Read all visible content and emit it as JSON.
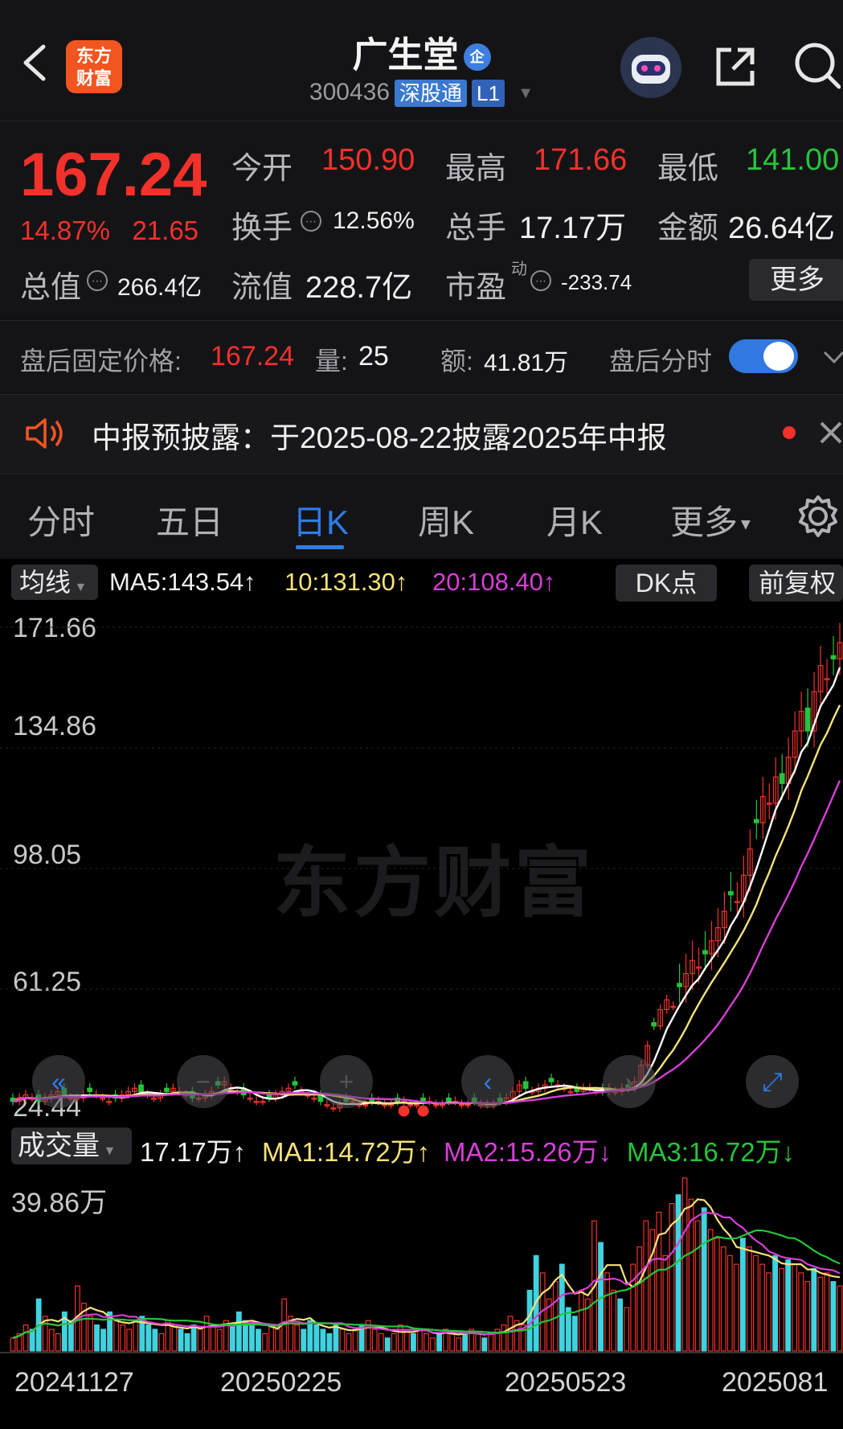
{
  "header": {
    "back_icon": "chevron-left-icon",
    "logo_line1": "东方",
    "logo_line2": "财富",
    "stock_name": "广生堂",
    "qi_badge": "企",
    "stock_code": "300436",
    "tag_shgt": "深股通",
    "tag_level": "L1",
    "robot_icon": "robot-avatar-icon",
    "share_icon": "share-icon",
    "search_icon": "search-icon"
  },
  "quote": {
    "price": "167.24",
    "change_pct": "14.87%",
    "change_amt": "21.65",
    "open_label": "今开",
    "open": "150.90",
    "high_label": "最高",
    "high": "171.66",
    "low_label": "最低",
    "low": "141.00",
    "turnover_label": "换手",
    "turnover": "12.56%",
    "volume_label": "总手",
    "volume": "17.17万",
    "amount_label": "金额",
    "amount": "26.64亿",
    "mktcap_label": "总值",
    "mktcap": "266.4亿",
    "float_label": "流值",
    "float": "228.7亿",
    "pe_label": "市盈",
    "pe_sup": "动",
    "pe": "-233.74",
    "more_label": "更多"
  },
  "after_hours": {
    "fixed_label": "盘后固定价格:",
    "fixed_price": "167.24",
    "vol_label": "量:",
    "vol": "25",
    "amt_label": "额:",
    "amt": "41.81万",
    "intraday_label": "盘后分时",
    "toggle_on": true
  },
  "notice": {
    "text": "中报预披露：于2025-08-22披露2025年中报"
  },
  "tabs": [
    "分时",
    "五日",
    "日K",
    "周K",
    "月K",
    "更多"
  ],
  "active_tab": "日K",
  "ma_bar": {
    "selector": "均线",
    "ma5": "MA5:143.54↑",
    "ma10": "10:131.30↑",
    "ma20": "20:108.40↑",
    "dk_label": "DK点",
    "adjust_label": "前复权"
  },
  "volume_bar": {
    "selector": "成交量",
    "vol": "17.17万↑",
    "ma1": "MA1:14.72万↑",
    "ma2": "MA2:15.26万↓",
    "ma3": "MA3:16.72万↓"
  },
  "watermark": "东方财富",
  "colors": {
    "up": "#f3312b",
    "down": "#26c43c",
    "accent": "#2e7de8",
    "ma5": "#ffffff",
    "ma10": "#f5e27a",
    "ma20": "#d63fd6"
  },
  "chart_data": {
    "type": "candlestick",
    "price_axis_labels": [
      "171.66",
      "134.86",
      "98.05",
      "61.25",
      "24.44"
    ],
    "price_range": [
      24.44,
      171.66
    ],
    "volume_axis_label": "39.86万",
    "volume_max_wan": 39.86,
    "date_labels": [
      "20241127",
      "20250225",
      "20250523",
      "2025081"
    ],
    "close_series": [
      27,
      28,
      29,
      28,
      27,
      28,
      29,
      30,
      29,
      28,
      28,
      29,
      30,
      29,
      28,
      27,
      28,
      29,
      30,
      31,
      30,
      29,
      28,
      29,
      30,
      31,
      30,
      29,
      28,
      28,
      29,
      30,
      32,
      33,
      31,
      30,
      29,
      28,
      27,
      27,
      28,
      29,
      30,
      31,
      32,
      30,
      29,
      28,
      27,
      26,
      25,
      26,
      27,
      27,
      26,
      26,
      27,
      27,
      26,
      26,
      27,
      27,
      26,
      26,
      27,
      27,
      26,
      26,
      27,
      27,
      26,
      26,
      27,
      26,
      26,
      26,
      27,
      28,
      30,
      32,
      31,
      30,
      31,
      32,
      33,
      32,
      31,
      30,
      30,
      31,
      31,
      30,
      30,
      31,
      30,
      31,
      31,
      33,
      38,
      44,
      50,
      55,
      58,
      56,
      62,
      66,
      70,
      68,
      72,
      76,
      80,
      85,
      90,
      88,
      96,
      104,
      112,
      120,
      118,
      126,
      124,
      132,
      140,
      146,
      140,
      152,
      160,
      156,
      162,
      167
    ],
    "volume_series_wan": [
      3,
      4,
      6,
      5,
      12,
      8,
      5,
      4,
      9,
      7,
      15,
      11,
      8,
      6,
      5,
      9,
      7,
      6,
      5,
      7,
      8,
      6,
      5,
      4,
      7,
      6,
      5,
      4,
      6,
      5,
      8,
      6,
      5,
      7,
      6,
      9,
      7,
      6,
      5,
      4,
      6,
      5,
      12,
      8,
      6,
      5,
      7,
      6,
      5,
      4,
      6,
      5,
      4,
      5,
      6,
      7,
      5,
      4,
      3,
      4,
      6,
      5,
      4,
      5,
      4,
      3,
      4,
      5,
      4,
      3,
      4,
      5,
      4,
      3,
      4,
      5,
      6,
      8,
      7,
      6,
      14,
      22,
      18,
      12,
      16,
      20,
      10,
      8,
      14,
      12,
      30,
      25,
      18,
      14,
      12,
      10,
      20,
      24,
      30,
      28,
      32,
      22,
      34,
      36,
      39.86,
      35,
      30,
      33,
      28,
      26,
      24,
      22,
      20,
      26,
      24,
      22,
      20,
      18,
      22,
      19,
      21,
      20,
      18,
      16,
      19,
      17,
      18,
      16,
      15
    ]
  }
}
